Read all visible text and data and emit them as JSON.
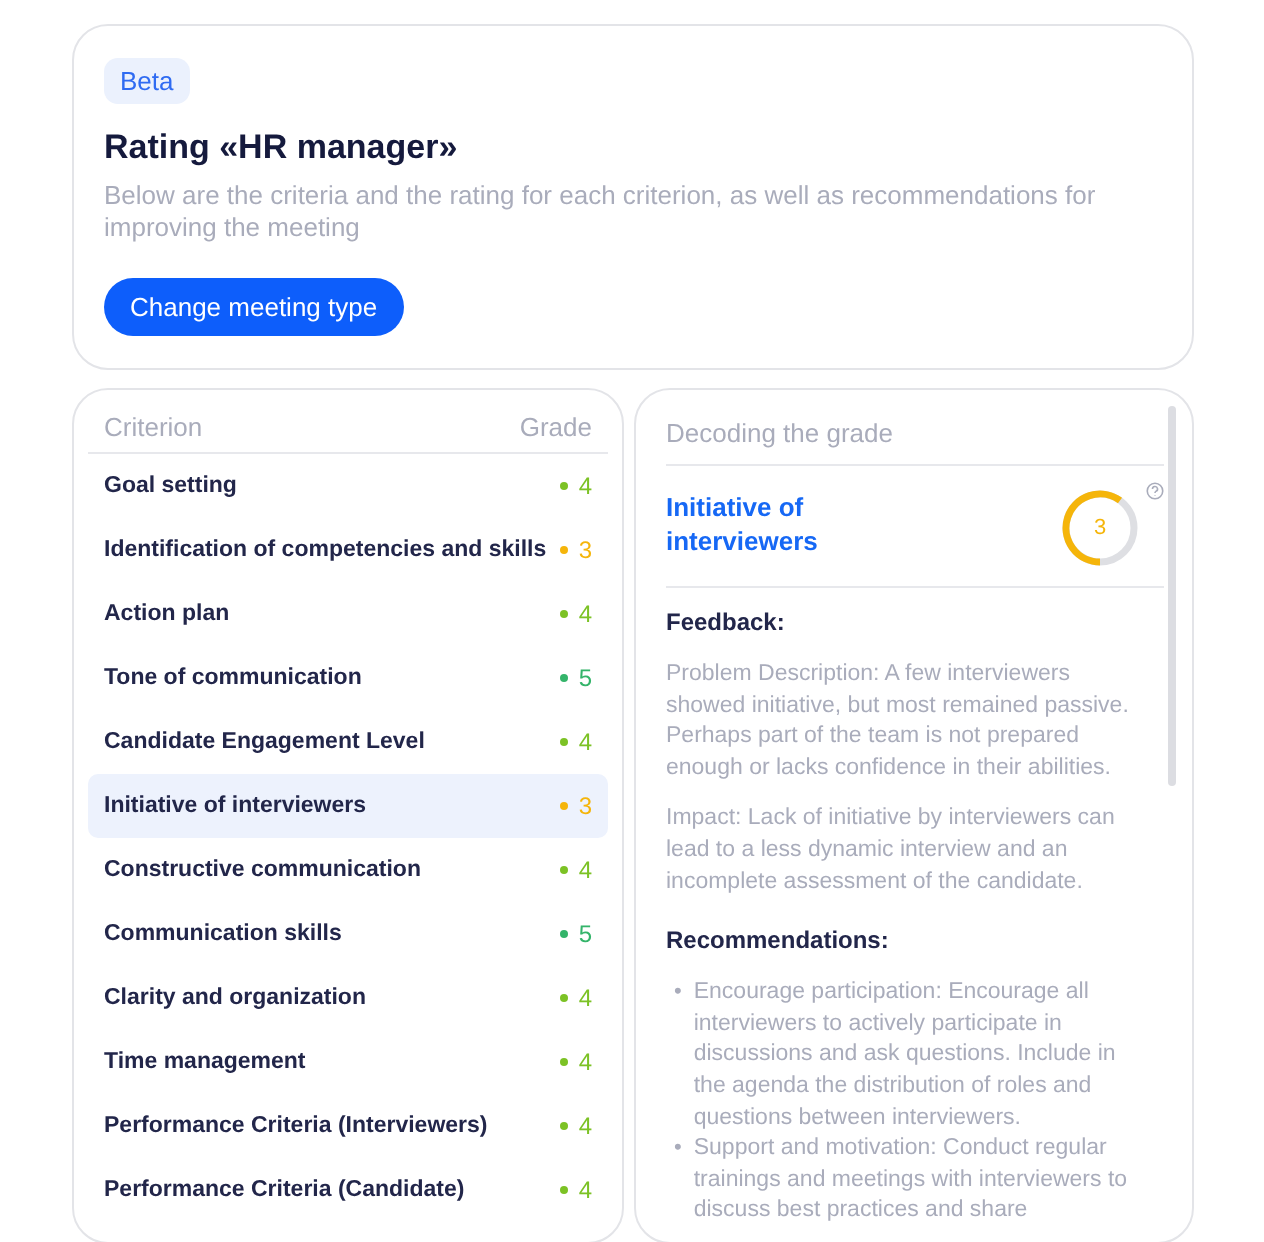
{
  "header": {
    "badge": "Beta",
    "title": "Rating «HR manager»",
    "description": "Below are the criteria and the rating for each criterion, as well as recommendations for improving the meeting",
    "button": "Change meeting type"
  },
  "criteria": {
    "columns": [
      "Criterion",
      "Grade"
    ],
    "rows": [
      {
        "name": "Goal setting",
        "grade": "4",
        "color": "#7cc225",
        "selected": false
      },
      {
        "name": "Identification of competencies and skills",
        "grade": "3",
        "color": "#f5b50a",
        "selected": false
      },
      {
        "name": "Action plan",
        "grade": "4",
        "color": "#7cc225",
        "selected": false
      },
      {
        "name": "Tone of communication",
        "grade": "5",
        "color": "#34b46a",
        "selected": false
      },
      {
        "name": "Candidate Engagement Level",
        "grade": "4",
        "color": "#7cc225",
        "selected": false
      },
      {
        "name": "Initiative of interviewers",
        "grade": "3",
        "color": "#f5b50a",
        "selected": true
      },
      {
        "name": "Constructive communication",
        "grade": "4",
        "color": "#7cc225",
        "selected": false
      },
      {
        "name": "Communication skills",
        "grade": "5",
        "color": "#34b46a",
        "selected": false
      },
      {
        "name": "Clarity and organization",
        "grade": "4",
        "color": "#7cc225",
        "selected": false
      },
      {
        "name": "Time management",
        "grade": "4",
        "color": "#7cc225",
        "selected": false
      },
      {
        "name": "Performance Criteria (Interviewers)",
        "grade": "4",
        "color": "#7cc225",
        "selected": false
      },
      {
        "name": "Performance Criteria (Candidate)",
        "grade": "4",
        "color": "#7cc225",
        "selected": false
      }
    ]
  },
  "decoding": {
    "title": "Decoding the grade",
    "criterion": "Initiative of interviewers",
    "score": {
      "value": "3",
      "level": 0.6,
      "color": "#f5b50a"
    },
    "feedback_heading": "Feedback:",
    "paragraphs": [
      "Problem Description: A few interviewers showed initiative, but most remained passive. Perhaps part of the team is not prepared enough or lacks confidence in their abilities.",
      "Impact: Lack of initiative by interviewers can lead to a less dynamic interview and an incomplete assessment of the candidate."
    ],
    "recommendations_heading": "Recommendations:",
    "recommendations": [
      {
        "marker": "•",
        "text": "Encourage participation: Encourage all interviewers to actively participate in discussions and ask questions. Include in the agenda the distribution of roles and questions between interviewers."
      },
      {
        "marker": "•",
        "text": "Support and motivation: Conduct regular trainings and meetings with interviewers to discuss best practices and share"
      }
    ]
  }
}
